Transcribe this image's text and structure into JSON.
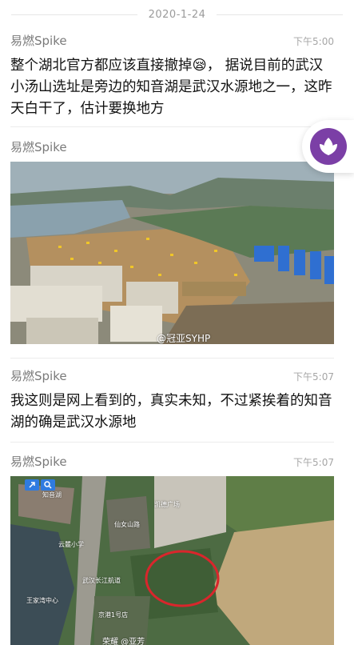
{
  "date_divider": "2020-1-24",
  "posts": [
    {
      "author": "易燃Spike",
      "time": "下午5:00",
      "text": "整个湖北官方都应该直接撤掉😪， 据说目前的武汉小汤山选址是旁边的知音湖是武汉水源地之一，这昨天白干了，估计要换地方"
    },
    {
      "author": "易燃Spike",
      "time": "",
      "image_watermark": "@冠亚SYHP"
    },
    {
      "author": "易燃Spike",
      "time": "下午5:07",
      "text": "我这则是网上看到的，真实未知，不过紧挨着的知音湖的确是武汉水源地"
    },
    {
      "author": "易燃Spike",
      "time": "下午5:07",
      "map_labels": [
        "知音湖",
        "武汉长江航道",
        "仙女山路",
        "云麓小学",
        "王家湾中心",
        "京港1号店",
        "凯德广场",
        "荣耀 @亚芳"
      ]
    }
  ],
  "floating_app": {
    "icon": "purple-leaf-app-icon",
    "color": "#7b3fa6"
  },
  "colors": {
    "map_circle": "#d9262c",
    "map_button": "#2f7be0"
  }
}
